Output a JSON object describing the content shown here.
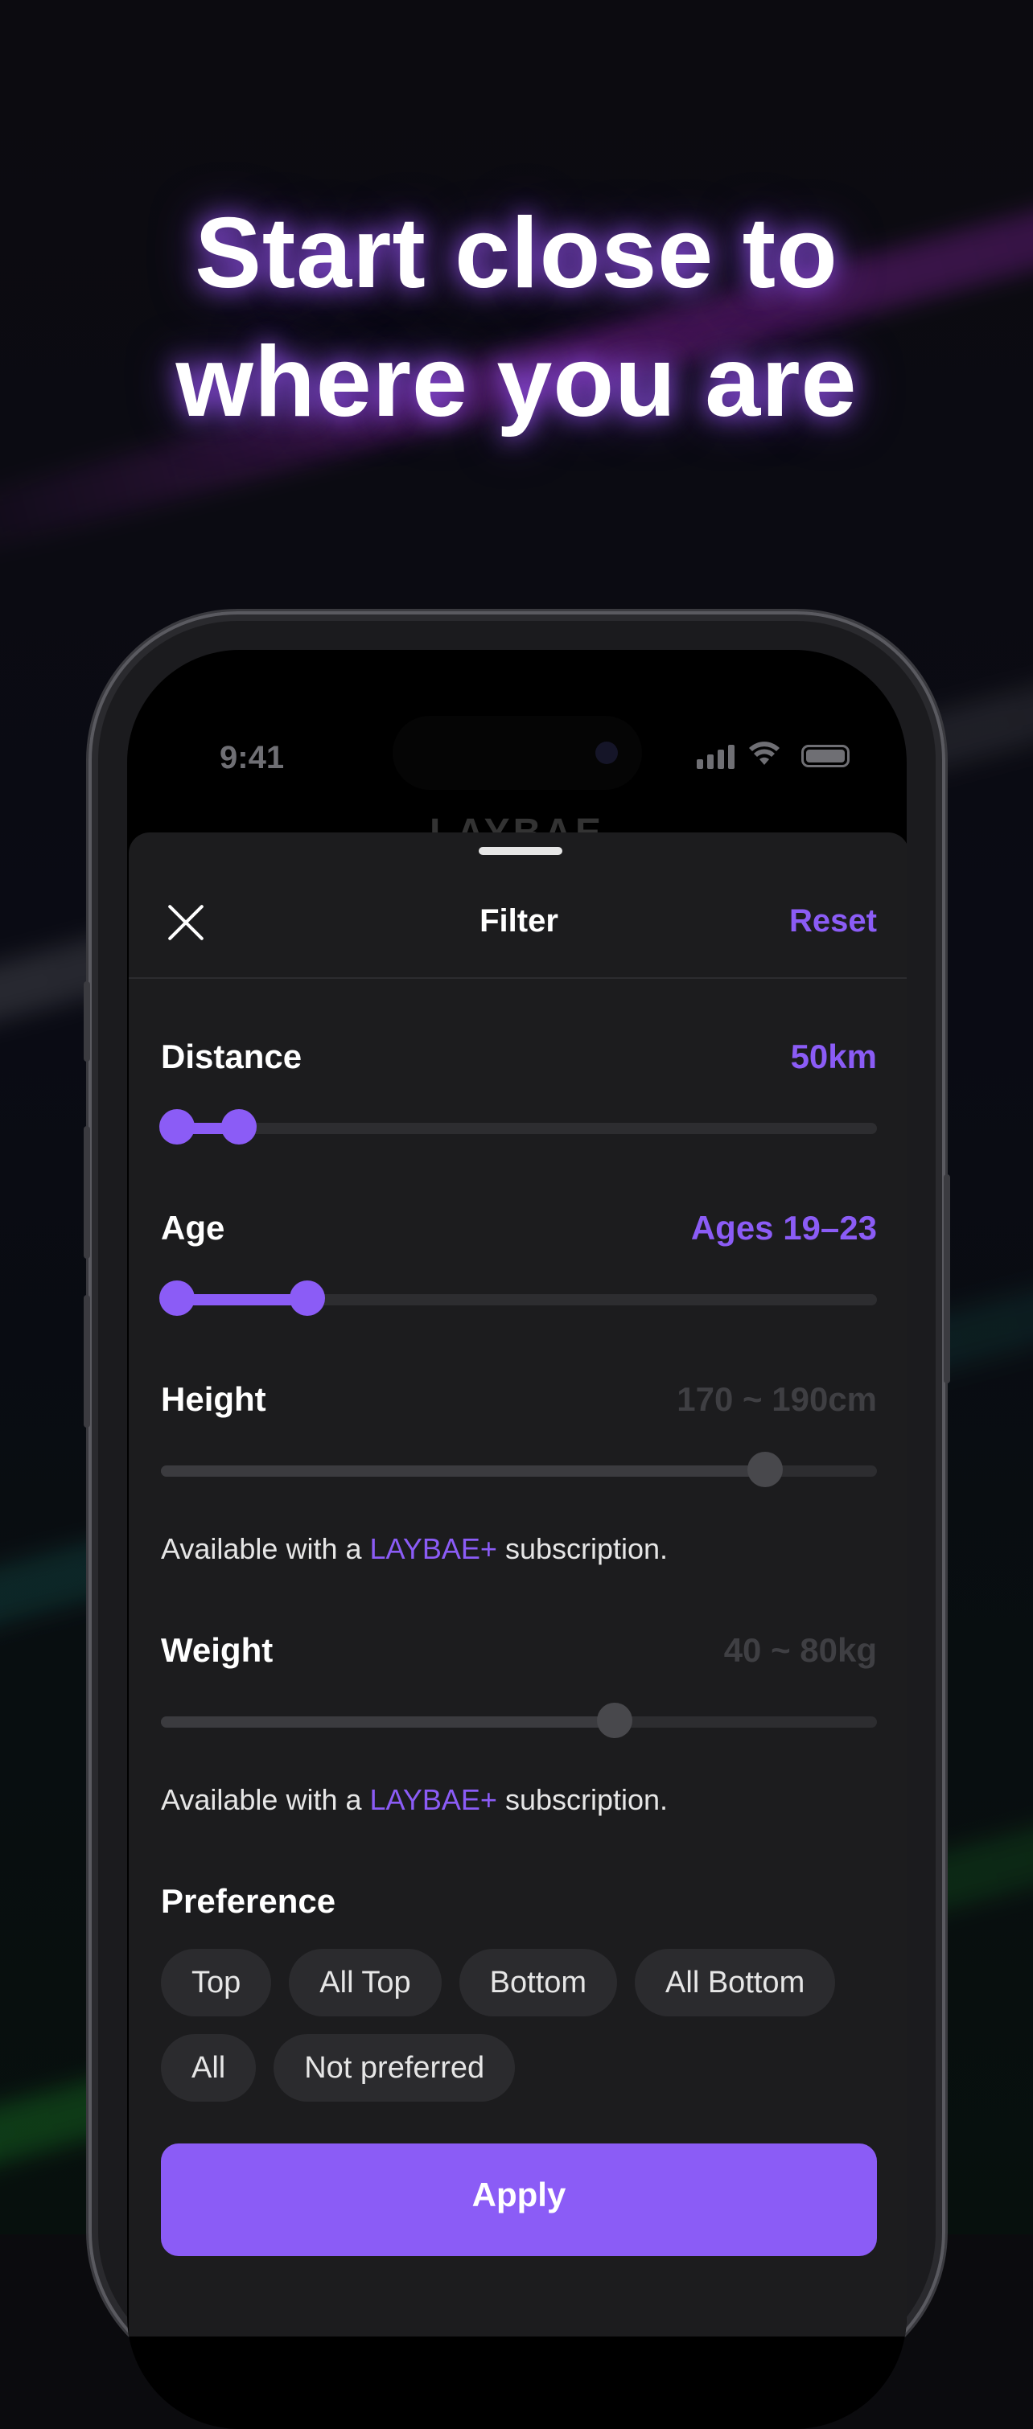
{
  "headline": {
    "line1": "Start close to",
    "line2": "where you are"
  },
  "status_bar": {
    "time": "9:41",
    "wifi_icon": "wifi-icon",
    "battery_icon": "battery-icon",
    "signal_icon": "cellular-signal-icon"
  },
  "app": {
    "title": "LAYBAE"
  },
  "sheet": {
    "title": "Filter",
    "reset_label": "Reset",
    "close_icon": "close-icon",
    "distance": {
      "label": "Distance",
      "value": "50km",
      "level": 0.09
    },
    "age": {
      "label": "Age",
      "value": "Ages 19–23",
      "range_start": 0,
      "range_end": 0.19
    },
    "height": {
      "label": "Height",
      "value": "170 ~ 190cm",
      "level": 0.86,
      "note_prefix": "Available with a ",
      "note_brand": "LAYBAE+",
      "note_suffix": " subscription."
    },
    "weight": {
      "label": "Weight",
      "value": "40 ~ 80kg",
      "level": 0.64,
      "note_prefix": "Available with a ",
      "note_brand": "LAYBAE+",
      "note_suffix": " subscription."
    },
    "preference": {
      "label": "Preference",
      "options": [
        "Top",
        "All Top",
        "Bottom",
        "All Bottom",
        "All",
        "Not preferred"
      ]
    },
    "apply_label": "Apply"
  },
  "colors": {
    "accent": "#8b5cf6",
    "sheet_bg": "#1c1c1e",
    "chip_bg": "#2b2b2e"
  }
}
